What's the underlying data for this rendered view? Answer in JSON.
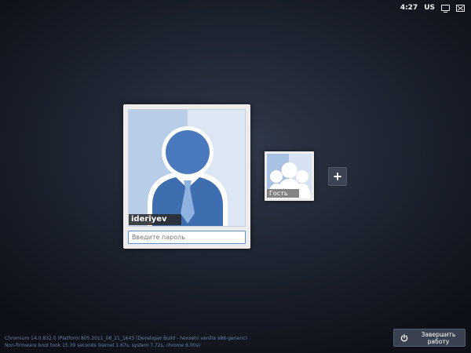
{
  "status_tray": {
    "time": "4:27",
    "keyboard_layout": "US",
    "icons": [
      "monitor-icon",
      "network-icon"
    ]
  },
  "user": {
    "name": "ideriyev",
    "password_placeholder": "Введите пароль",
    "password_value": ""
  },
  "guest": {
    "label": "Гость"
  },
  "add_user": {
    "label": "+"
  },
  "version_info": {
    "line1": "Chromium 14.0.832.0 (Platform 805.2011_08_21_1643 (Developer Build - hexxeh) vanilla x86-generic)",
    "line2": "Non-firmware boot took 15.39 seconds (kernel 1.67s, system 7.72s, chrome 6.00s)"
  },
  "shutdown": {
    "label": "Завершить работу",
    "icon": "power-icon"
  },
  "colors": {
    "background": "#1c222e",
    "accent": "#5b8fd8",
    "avatar_blue": "#3f6fb3"
  }
}
